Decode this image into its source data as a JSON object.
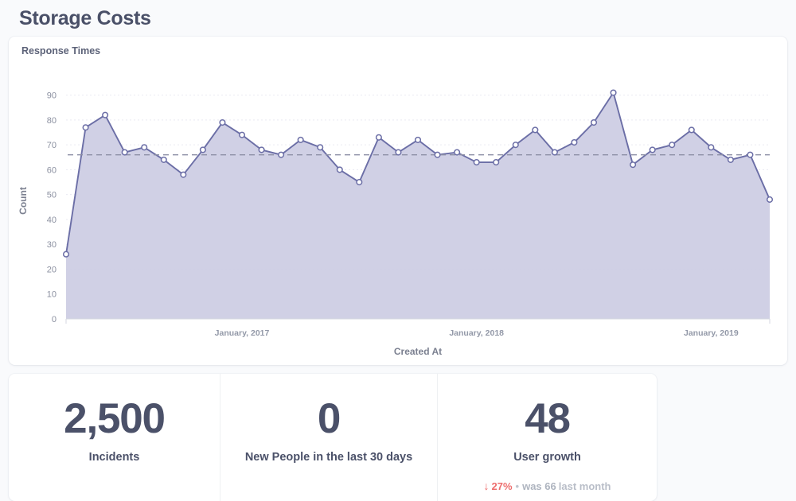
{
  "page": {
    "title": "Storage Costs",
    "background_color": "#f9fafc"
  },
  "chart_card": {
    "heading": "Response Times"
  },
  "chart_data": {
    "type": "area",
    "title": "Response Times",
    "xlabel": "Created At",
    "ylabel": "Count",
    "ylim": [
      0,
      95
    ],
    "yticks": [
      0,
      10,
      20,
      30,
      40,
      50,
      60,
      70,
      80,
      90
    ],
    "xtick_labels": [
      "January, 2017",
      "January, 2018",
      "January, 2019"
    ],
    "xtick_positions": [
      9,
      21,
      33
    ],
    "grid": true,
    "legend": "none",
    "line_color": "#6b6ea6",
    "fill_color": "#cdcde4",
    "marker_color": "#ffffff",
    "goal_line": {
      "value": 66,
      "style": "dashed",
      "color": "#8d90a6"
    },
    "series": [
      {
        "name": "Count",
        "values": [
          26,
          77,
          82,
          67,
          69,
          64,
          58,
          68,
          79,
          74,
          68,
          66,
          72,
          69,
          60,
          55,
          73,
          67,
          72,
          66,
          67,
          63,
          63,
          70,
          76,
          67,
          71,
          79,
          91,
          62,
          68,
          70,
          76,
          69,
          64,
          66,
          48
        ]
      }
    ]
  },
  "stats": {
    "cards": [
      {
        "value": "2,500",
        "label": "Incidents",
        "trend": null
      },
      {
        "value": "0",
        "label": "New People in the last 30 days",
        "trend": null
      },
      {
        "value": "48",
        "label": "User growth",
        "trend": {
          "arrow": "↓",
          "percent": "27%",
          "separator": "•",
          "was_text": "was 66",
          "period_text": "last month",
          "color": "#ed6e6e"
        }
      }
    ]
  }
}
